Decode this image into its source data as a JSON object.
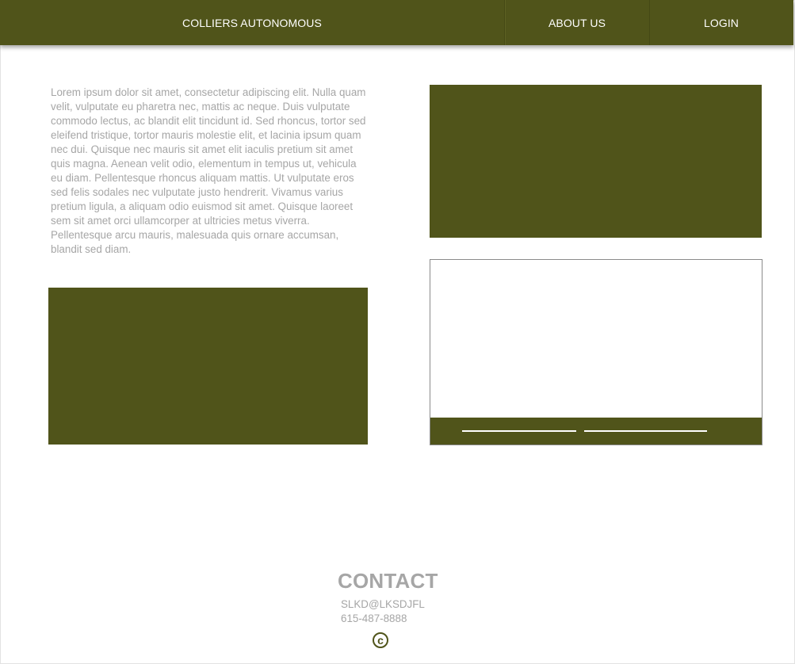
{
  "nav": {
    "brand": "COLLIERS AUTONOMOUS",
    "about": "ABOUT US",
    "login": "LOGIN"
  },
  "intro": {
    "text": "Lorem ipsum dolor sit amet, consectetur adipiscing elit. Nulla quam velit, vulputate eu pharetra nec, mattis ac neque. Duis vulputate commodo lectus, ac blandit elit tincidunt id. Sed rhoncus, tortor sed eleifend tristique, tortor mauris molestie elit, et lacinia ipsum quam nec dui. Quisque nec mauris sit amet elit iaculis pretium sit amet quis magna. Aenean velit odio, elementum in tempus ut, vehicula eu diam. Pellentesque rhoncus aliquam mattis. Ut vulputate eros sed felis sodales nec vulputate justo hendrerit. Vivamus varius pretium ligula, a aliquam odio euismod sit amet. Quisque laoreet sem sit amet orci ullamcorper at ultricies metus viverra. Pellentesque arcu mauris, malesuada quis ornare accumsan, blandit sed diam."
  },
  "contact": {
    "title": "CONTACT",
    "email": "SLKD@LKSDJFL",
    "phone": "615-487-8888",
    "copyright_symbol": "c"
  },
  "colors": {
    "brand": "#50541a",
    "muted_text": "#a6a6a6",
    "background": "#ffffff"
  }
}
